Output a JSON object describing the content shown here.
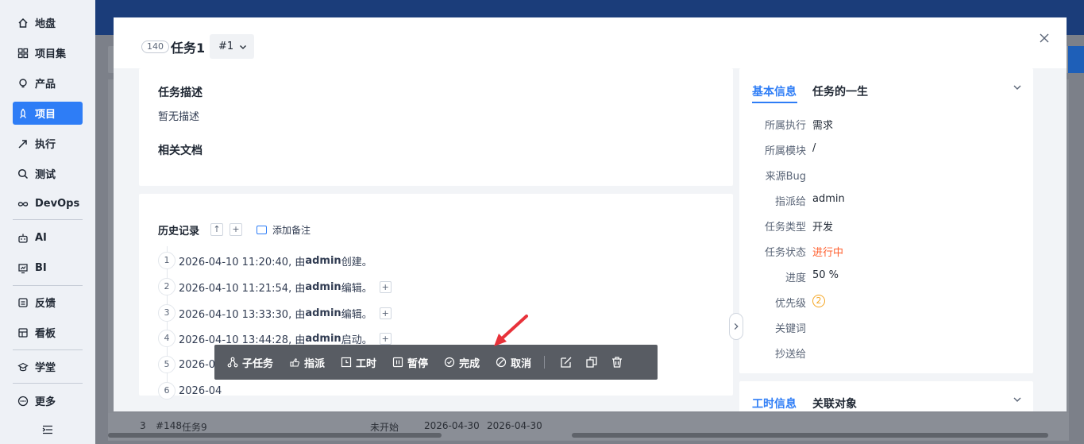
{
  "sidebar": {
    "items": [
      {
        "label": "地盘",
        "icon": "home-icon"
      },
      {
        "label": "项目集",
        "icon": "grid-icon"
      },
      {
        "label": "产品",
        "icon": "bulb-icon"
      },
      {
        "label": "项目",
        "icon": "rocket-icon",
        "active": true
      },
      {
        "label": "执行",
        "icon": "arrow-icon"
      },
      {
        "label": "测试",
        "icon": "search-icon"
      },
      {
        "label": "DevOps",
        "icon": "infinity-icon"
      },
      {
        "label": "AI",
        "icon": "robot-icon"
      },
      {
        "label": "BI",
        "icon": "chart-icon"
      },
      {
        "label": "反馈",
        "icon": "feedback-icon"
      },
      {
        "label": "看板",
        "icon": "board-icon"
      },
      {
        "label": "学堂",
        "icon": "school-icon"
      },
      {
        "label": "更多",
        "icon": "more-icon"
      }
    ],
    "collapse_icon": "collapse-icon"
  },
  "background": {
    "row": {
      "id": "3",
      "code": "#148",
      "name": "任务9",
      "status": "未开始",
      "date1": "2026-04-30",
      "date2": "2026-04-30"
    }
  },
  "modal": {
    "id": "140",
    "title": "任务1",
    "version": "#1",
    "description_title": "任务描述",
    "description_text": "暂无描述",
    "docs_title": "相关文档",
    "history": {
      "title": "历史记录",
      "add_note": "添加备注",
      "entries": [
        {
          "num": "1",
          "time": "2026-04-10 11:20:40, 由 ",
          "user": "admin",
          "action": " 创建。"
        },
        {
          "num": "2",
          "time": "2026-04-10 11:21:54, 由 ",
          "user": "admin",
          "action": " 编辑。"
        },
        {
          "num": "3",
          "time": "2026-04-10 13:33:30, 由 ",
          "user": "admin",
          "action": " 编辑。"
        },
        {
          "num": "4",
          "time": "2026-04-10 13:44:28, 由 ",
          "user": "admin",
          "action": " 启动。"
        },
        {
          "num": "5",
          "time": "2026-04",
          "user": "",
          "action": ""
        },
        {
          "num": "6",
          "time": "2026-04",
          "user": "",
          "action": ""
        }
      ]
    },
    "info": {
      "tab_basic": "基本信息",
      "tab_life": "任务的一生",
      "fields": [
        {
          "label": "所属执行",
          "value": "需求"
        },
        {
          "label": "所属模块",
          "value": "/"
        },
        {
          "label": "来源Bug",
          "value": ""
        },
        {
          "label": "指派给",
          "value": "admin"
        },
        {
          "label": "任务类型",
          "value": "开发"
        },
        {
          "label": "任务状态",
          "value": "进行中"
        },
        {
          "label": "进度",
          "value": "50 %"
        },
        {
          "label": "优先级",
          "value": "2"
        },
        {
          "label": "关键词",
          "value": ""
        },
        {
          "label": "抄送给",
          "value": ""
        }
      ],
      "status_color": "#ff5d2b"
    },
    "time": {
      "tab_time": "工时信息",
      "tab_related": "关联对象"
    }
  },
  "toolbar": {
    "subtask": "子任务",
    "assign": "指派",
    "worklog": "工时",
    "pause": "暂停",
    "finish": "完成",
    "cancel": "取消"
  },
  "colors": {
    "accent": "#2e7df6",
    "status": "#ff5d2b",
    "annotation": "#e8323a"
  }
}
